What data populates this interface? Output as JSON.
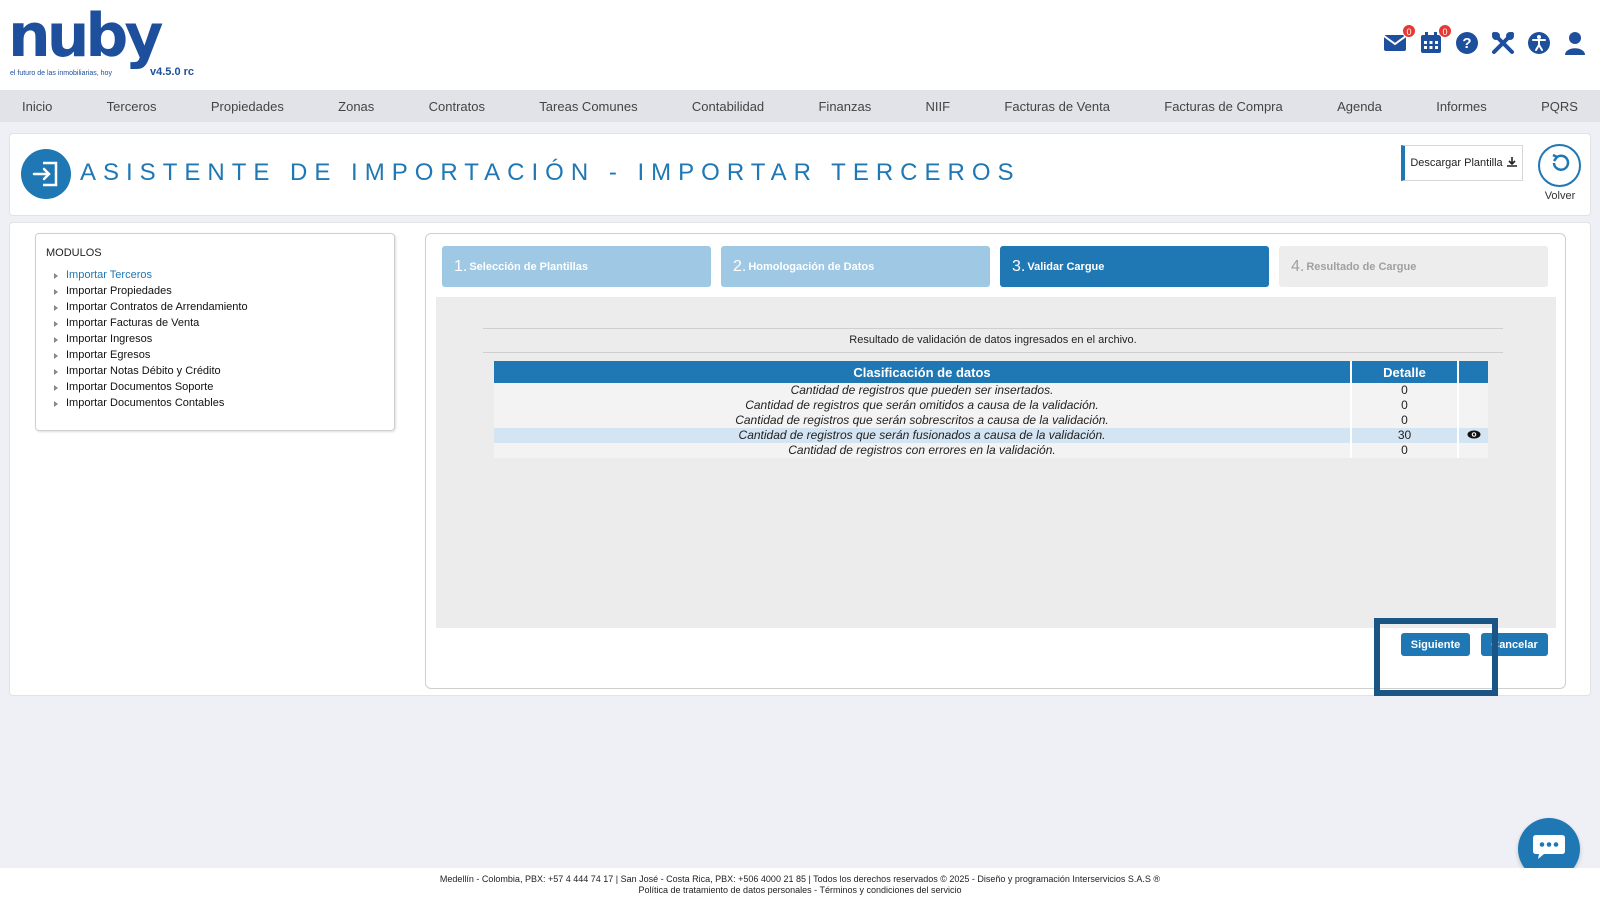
{
  "header": {
    "logo_text": "nuby",
    "tagline": "el futuro de las inmobiliarias, hoy",
    "version": "v4.5.0 rc",
    "mail_badge": "0",
    "calendar_badge": "0",
    "icons": [
      "mail-icon",
      "calendar-icon",
      "help-icon",
      "tools-icon",
      "accessibility-icon",
      "user-icon"
    ]
  },
  "nav": {
    "items": [
      "Inicio",
      "Terceros",
      "Propiedades",
      "Zonas",
      "Contratos",
      "Tareas Comunes",
      "Contabilidad",
      "Finanzas",
      "NIIF",
      "Facturas de Venta",
      "Facturas de Compra",
      "Agenda",
      "Informes",
      "PQRS"
    ]
  },
  "title_panel": {
    "title": "ASISTENTE DE IMPORTACIÓN - IMPORTAR TERCEROS",
    "download_label": "Descargar Plantilla",
    "back_label": "Volver"
  },
  "modules": {
    "title": "MODULOS",
    "items": [
      "Importar Terceros",
      "Importar Propiedades",
      "Importar Contratos de Arrendamiento",
      "Importar Facturas de Venta",
      "Importar Ingresos",
      "Importar Egresos",
      "Importar Notas Débito y Crédito",
      "Importar Documentos Soporte",
      "Importar Documentos Contables"
    ]
  },
  "wizard": {
    "steps": [
      {
        "num": "1.",
        "label": "Selección de Plantillas"
      },
      {
        "num": "2.",
        "label": "Homologación de Datos"
      },
      {
        "num": "3.",
        "label": "Validar Cargue"
      },
      {
        "num": "4.",
        "label": "Resultado de Cargue"
      }
    ],
    "result_text": "Resultado de validación de datos ingresados en el archivo.",
    "table": {
      "headers": [
        "Clasificación de datos",
        "Detalle"
      ],
      "rows": [
        {
          "desc": "Cantidad de registros que pueden ser insertados.",
          "value": "0"
        },
        {
          "desc": "Cantidad de registros que serán omitidos a causa de la validación.",
          "value": "0"
        },
        {
          "desc": "Cantidad de registros que serán sobrescritos a causa de la validación.",
          "value": "0"
        },
        {
          "desc": "Cantidad de registros que serán fusionados a causa de la validación.",
          "value": "30"
        },
        {
          "desc": "Cantidad de registros con errores en la validación.",
          "value": "0"
        }
      ]
    },
    "next_label": "Siguiente",
    "cancel_label": "Cancelar"
  },
  "footer": {
    "line1": "Medellín - Colombia, PBX: +57 4 444 74 17 | San José - Costa Rica, PBX: +506 4000 21 85 | Todos los derechos reservados © 2025 - Diseño y programación Interservicios S.A.S ®",
    "line2": "Política de tratamiento de datos personales - Términos y condiciones del servicio"
  },
  "colors": {
    "primary": "#1f77b4",
    "brand": "#1d4f9c",
    "step_light": "#9ec8e4",
    "badge": "#e53935"
  }
}
